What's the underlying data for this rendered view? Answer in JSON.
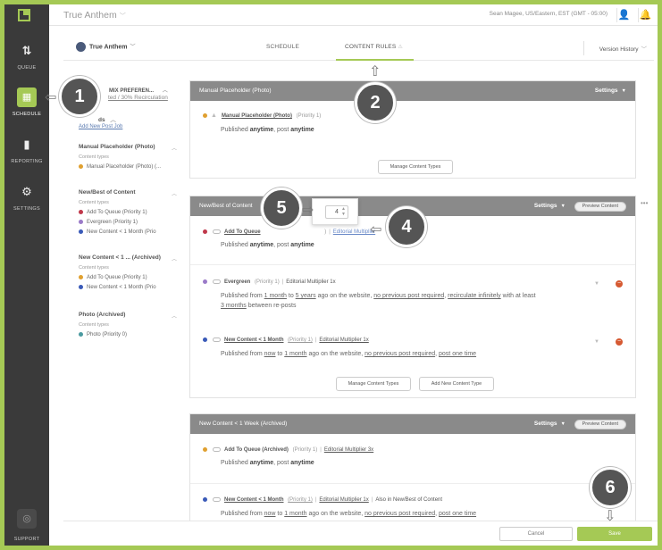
{
  "app": {
    "title": "True Anthem",
    "user_info": "Sean Magee, US/Eastern, EST (GMT - 05:00)"
  },
  "sidebar": {
    "items": [
      {
        "label": "QUEUE",
        "icon": "queue-icon"
      },
      {
        "label": "SCHEDULE",
        "icon": "calendar-icon"
      },
      {
        "label": "REPORTING",
        "icon": "bar-chart-icon"
      },
      {
        "label": "SETTINGS",
        "icon": "gear-icon"
      }
    ],
    "support": "SUPPORT"
  },
  "header": {
    "account": "True Anthem",
    "tabs": [
      "SCHEDULE",
      "CONTENT RULES"
    ],
    "version_history": "Version History"
  },
  "rules": {
    "mix_heading": "MIX PREFEREN...",
    "mix_sub": "ted / 30% Recirculation",
    "ds_heading": "ds",
    "add_post_job": "Add New Post Job",
    "groups": [
      {
        "title": "Manual Placeholder (Photo)",
        "ctypes": "Content types",
        "items": [
          {
            "label": "Manual Placeholder (Photo) (...",
            "color": "#e0a030"
          }
        ]
      },
      {
        "title": "New/Best of Content",
        "ctypes": "Content types",
        "items": [
          {
            "label": "Add To Queue (Priority 1)",
            "color": "#c0384a"
          },
          {
            "label": "Evergreen (Priority 1)",
            "color": "#9a7ac8"
          },
          {
            "label": "New Content < 1 Month (Prio",
            "color": "#3a5ab8"
          }
        ]
      },
      {
        "title": "New Content < 1 ... (Archived)",
        "ctypes": "Content types",
        "items": [
          {
            "label": "Add To Queue (Priority 1)",
            "color": "#e0a030"
          },
          {
            "label": "New Content < 1 Month (Prio",
            "color": "#3a5ab8"
          }
        ]
      },
      {
        "title": "Photo (Archived)",
        "ctypes": "Content types",
        "items": [
          {
            "label": "Photo (Priority 0)",
            "color": "#4a9aa0"
          }
        ]
      }
    ]
  },
  "cards": {
    "manual": {
      "title": "Manual Placeholder (Photo)",
      "settings": "Settings",
      "entry_name": "Manual Placeholder (Photo)",
      "entry_priority": "(Priority 1)",
      "desc_pre": "Published ",
      "desc_b1": "anytime",
      "desc_mid": ", post ",
      "desc_b2": "anytime",
      "manage_btn": "Manage Content Types"
    },
    "newbest": {
      "title": "New/Best of Content",
      "settings": "Settings",
      "preview": "Preview Content",
      "stepper_value": "4",
      "e1_name": "Add To Queue",
      "e1_rest": ")",
      "e1_mult": "Editorial Multiplier",
      "e1_desc_pre": "Published ",
      "e1_desc_b1": "anytime",
      "e1_desc_mid": ", post ",
      "e1_desc_b2": "anytime",
      "e2_name": "Evergreen",
      "e2_priority": "(Priority 1)",
      "e2_mult": "Editorial Multiplier 1x",
      "e2_d1": "Published from ",
      "e2_u1": "1 month",
      "e2_d2": " to ",
      "e2_u2": "5 years",
      "e2_d3": " ago on the website, ",
      "e2_u3": "no previous post required",
      "e2_d4": ", ",
      "e2_u4": "recirculate infinitely",
      "e2_d5": " with at least",
      "e2_u5": "3 months",
      "e2_d6": " between re-posts",
      "e3_name": "New Content < 1 Month",
      "e3_priority": "(Priority 1)",
      "e3_mult": "Editorial Multiplier 1x",
      "e3_d1": "Published from ",
      "e3_u1": "now",
      "e3_d2": " to ",
      "e3_u2": "1 month",
      "e3_d3": " ago on the website, ",
      "e3_u3": "no previous post required",
      "e3_d4": ", ",
      "e3_u4": "post one time",
      "manage_btn": "Manage Content Types",
      "add_btn": "Add New Content Type"
    },
    "archived": {
      "title": "New Content < 1 Week (Archived)",
      "settings": "Settings",
      "preview": "Preview Content",
      "e1_name": "Add To Queue (Archived)",
      "e1_priority": "(Priority 1)",
      "e1_mult": "Editorial Multiplier 3x",
      "e1_desc_pre": "Published ",
      "e1_desc_b1": "anytime",
      "e1_desc_mid": ", post ",
      "e1_desc_b2": "anytime",
      "e2_name": "New Content < 1 Month",
      "e2_priority": "(Priority 1)",
      "e2_mult": "Editorial Multiplier 1x",
      "e2_also": "Also in New/Best of Content",
      "e2_d1": "Published from ",
      "e2_u1": "now",
      "e2_d2": " to ",
      "e2_u2": "1 month",
      "e2_d3": " ago on the website, ",
      "e2_u3": "no previous post required",
      "e2_d4": ", ",
      "e2_u4": "post one time"
    }
  },
  "footer": {
    "cancel": "Cancel",
    "save": "Save"
  },
  "callouts": [
    "1",
    "2",
    "4",
    "5",
    "6"
  ],
  "colors": {
    "accent": "#a5c955",
    "sidebar_bg": "#3a3a3a",
    "card_header": "#8a8a8a",
    "remove": "#d65a32"
  }
}
